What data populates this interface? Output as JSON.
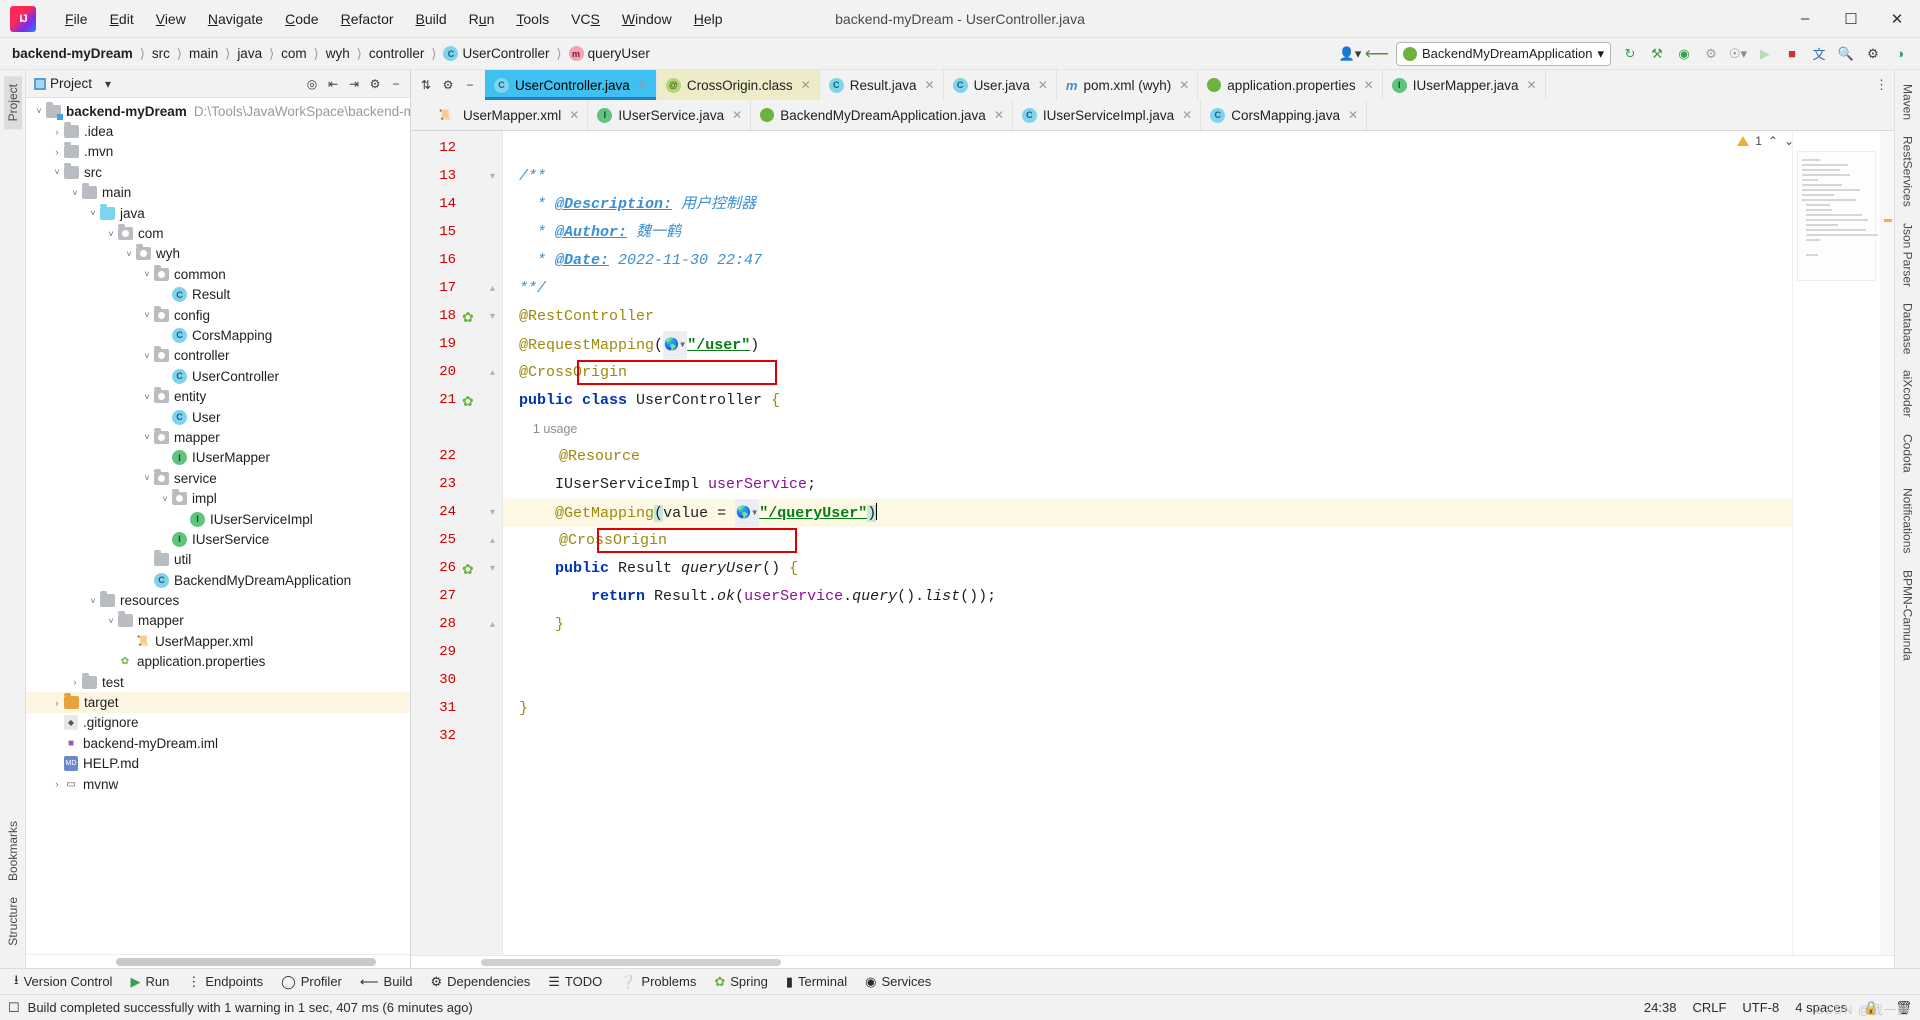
{
  "window": {
    "title": "backend-myDream - UserController.java",
    "logo_text": "IJ",
    "minimize": "–",
    "maximize": "❐",
    "close": "✕"
  },
  "menu": [
    "File",
    "Edit",
    "View",
    "Navigate",
    "Code",
    "Refactor",
    "Build",
    "Run",
    "Tools",
    "VCS",
    "Window",
    "Help"
  ],
  "breadcrumbs": [
    {
      "label": "backend-myDream",
      "bold": true,
      "icon": ""
    },
    {
      "label": "src",
      "bold": false,
      "icon": ""
    },
    {
      "label": "main",
      "bold": false,
      "icon": ""
    },
    {
      "label": "java",
      "bold": false,
      "icon": ""
    },
    {
      "label": "com",
      "bold": false,
      "icon": ""
    },
    {
      "label": "wyh",
      "bold": false,
      "icon": ""
    },
    {
      "label": "controller",
      "bold": false,
      "icon": ""
    },
    {
      "label": "UserController",
      "bold": false,
      "icon": "class-badge"
    },
    {
      "label": "queryUser",
      "bold": false,
      "icon": "method-badge"
    }
  ],
  "toolbar": {
    "run_config": "BackendMyDreamApplication",
    "user_icon": "user-settings-icon",
    "back_icon": "back-arrow-icon",
    "icons": [
      "build-icon",
      "run-with-coverage-icon",
      "debug-icon",
      "profile-icon",
      "search-everywhere-icon",
      "run-icon",
      "stop-icon",
      "translate-icon",
      "search-icon",
      "settings-icon",
      "ai-assistant-icon"
    ],
    "dropdown_caret": "▾"
  },
  "project_panel": {
    "title": "Project",
    "caret": "▾",
    "header_icons": [
      "locate-icon",
      "expand-all-icon",
      "collapse-all-icon",
      "settings-icon",
      "hide-icon"
    ],
    "tree": [
      {
        "depth": 0,
        "arrow": "˅",
        "icon": "module-folder",
        "label": "backend-myDream",
        "bold": true,
        "path": "D:\\Tools\\JavaWorkSpace\\backend-my"
      },
      {
        "depth": 1,
        "arrow": "›",
        "icon": "folder",
        "label": ".idea"
      },
      {
        "depth": 1,
        "arrow": "›",
        "icon": "folder",
        "label": ".mvn"
      },
      {
        "depth": 1,
        "arrow": "˅",
        "icon": "folder",
        "label": "src"
      },
      {
        "depth": 2,
        "arrow": "˅",
        "icon": "folder",
        "label": "main"
      },
      {
        "depth": 3,
        "arrow": "˅",
        "icon": "folder-blue",
        "label": "java"
      },
      {
        "depth": 4,
        "arrow": "˅",
        "icon": "package",
        "label": "com"
      },
      {
        "depth": 5,
        "arrow": "˅",
        "icon": "package",
        "label": "wyh"
      },
      {
        "depth": 6,
        "arrow": "˅",
        "icon": "package",
        "label": "common"
      },
      {
        "depth": 7,
        "arrow": "",
        "icon": "class",
        "label": "Result"
      },
      {
        "depth": 6,
        "arrow": "˅",
        "icon": "package",
        "label": "config"
      },
      {
        "depth": 7,
        "arrow": "",
        "icon": "class",
        "label": "CorsMapping"
      },
      {
        "depth": 6,
        "arrow": "˅",
        "icon": "package",
        "label": "controller"
      },
      {
        "depth": 7,
        "arrow": "",
        "icon": "class",
        "label": "UserController"
      },
      {
        "depth": 6,
        "arrow": "˅",
        "icon": "package",
        "label": "entity"
      },
      {
        "depth": 7,
        "arrow": "",
        "icon": "class",
        "label": "User"
      },
      {
        "depth": 6,
        "arrow": "˅",
        "icon": "package",
        "label": "mapper"
      },
      {
        "depth": 7,
        "arrow": "",
        "icon": "interface",
        "label": "IUserMapper"
      },
      {
        "depth": 6,
        "arrow": "˅",
        "icon": "package",
        "label": "service"
      },
      {
        "depth": 7,
        "arrow": "˅",
        "icon": "package",
        "label": "impl"
      },
      {
        "depth": 8,
        "arrow": "",
        "icon": "interface",
        "label": "IUserServiceImpl"
      },
      {
        "depth": 7,
        "arrow": "",
        "icon": "interface",
        "label": "IUserService"
      },
      {
        "depth": 6,
        "arrow": "",
        "icon": "folder",
        "label": "util"
      },
      {
        "depth": 6,
        "arrow": "",
        "icon": "class",
        "label": "BackendMyDreamApplication"
      },
      {
        "depth": 3,
        "arrow": "˅",
        "icon": "folder",
        "label": "resources"
      },
      {
        "depth": 4,
        "arrow": "˅",
        "icon": "folder",
        "label": "mapper"
      },
      {
        "depth": 5,
        "arrow": "",
        "icon": "xml-file",
        "label": "UserMapper.xml"
      },
      {
        "depth": 4,
        "arrow": "",
        "icon": "properties-file",
        "label": "application.properties"
      },
      {
        "depth": 2,
        "arrow": "›",
        "icon": "folder",
        "label": "test"
      },
      {
        "depth": 1,
        "arrow": "›",
        "icon": "folder-orange",
        "label": "target",
        "selected": true
      },
      {
        "depth": 1,
        "arrow": "",
        "icon": "git-file",
        "label": ".gitignore"
      },
      {
        "depth": 1,
        "arrow": "",
        "icon": "iml-file",
        "label": "backend-myDream.iml"
      },
      {
        "depth": 1,
        "arrow": "",
        "icon": "md-file",
        "label": "HELP.md"
      },
      {
        "depth": 1,
        "arrow": "›",
        "icon": "sh-file",
        "label": "mvnw"
      }
    ]
  },
  "editor_tabs_row1": [
    {
      "label": "UserController.java",
      "icon": "class",
      "active": true
    },
    {
      "label": "CrossOrigin.class",
      "icon": "annotation",
      "active": false,
      "compiled": true
    },
    {
      "label": "Result.java",
      "icon": "class",
      "active": false
    },
    {
      "label": "User.java",
      "icon": "class",
      "active": false
    },
    {
      "label": "pom.xml (wyh)",
      "icon": "maven",
      "active": false
    },
    {
      "label": "application.properties",
      "icon": "properties",
      "active": false
    },
    {
      "label": "IUserMapper.java",
      "icon": "interface",
      "active": false
    }
  ],
  "editor_tabs_row2": [
    {
      "label": "UserMapper.xml",
      "icon": "xml"
    },
    {
      "label": "IUserService.java",
      "icon": "interface"
    },
    {
      "label": "BackendMyDreamApplication.java",
      "icon": "spring"
    },
    {
      "label": "IUserServiceImpl.java",
      "icon": "class"
    },
    {
      "label": "CorsMapping.java",
      "icon": "class"
    }
  ],
  "inspection": {
    "warning_count": "1",
    "up_caret": "⌃",
    "down_caret": "⌄"
  },
  "code": {
    "lines": [
      {
        "num": "12",
        "text": "",
        "gutter_icon": "",
        "fold": ""
      },
      {
        "num": "13",
        "text": "/**",
        "fold": "minus",
        "kind": "comment"
      },
      {
        "num": "14",
        "text": " * @Description: 用户控制器",
        "kind": "comment-tag",
        "tag": "@Description:",
        "value": "用户控制器"
      },
      {
        "num": "15",
        "text": " * @Author: 魏一鹤",
        "kind": "comment-tag",
        "tag": "@Author:",
        "value": "魏一鹤"
      },
      {
        "num": "16",
        "text": " * @Date: 2022-11-30 22:47",
        "kind": "comment-tag",
        "tag": "@Date:",
        "value": "2022-11-30 22:47"
      },
      {
        "num": "17",
        "text": "**/",
        "fold": "end",
        "kind": "comment"
      },
      {
        "num": "18",
        "text": "@RestController",
        "kind": "annotation",
        "gutter_icon": "spring-bean-icon",
        "fold": "minus"
      },
      {
        "num": "19",
        "text": "@RequestMapping(\"/user\")",
        "kind": "annotation-mapping",
        "mapping": "/user"
      },
      {
        "num": "20",
        "text": "@CrossOrigin",
        "kind": "annotation",
        "highlight_box": true,
        "fold": "end"
      },
      {
        "num": "21",
        "text": "public class UserController {",
        "kind": "decl",
        "gutter_icon": "spring-controller-icon"
      },
      {
        "num": "",
        "text": "1 usage",
        "kind": "usage"
      },
      {
        "num": "22",
        "text": "@Resource",
        "kind": "annotation"
      },
      {
        "num": "23",
        "text": "IUserServiceImpl userService;",
        "kind": "field"
      },
      {
        "num": "24",
        "text": "@GetMapping(value = \"/queryUser\")",
        "kind": "annotation-mapping",
        "mapping": "/queryUser",
        "current": true,
        "fold": "minus"
      },
      {
        "num": "25",
        "text": "@CrossOrigin",
        "kind": "annotation",
        "highlight_box": true,
        "fold": "end"
      },
      {
        "num": "26",
        "text": "public Result queryUser() {",
        "kind": "decl",
        "gutter_icon": "spring-mapping-icon",
        "fold": "minus"
      },
      {
        "num": "27",
        "text": "return Result.ok(userService.query().list());",
        "kind": "stmt"
      },
      {
        "num": "28",
        "text": "}",
        "kind": "plain",
        "fold": "end"
      },
      {
        "num": "29",
        "text": "",
        "kind": "plain"
      },
      {
        "num": "30",
        "text": "",
        "kind": "plain"
      },
      {
        "num": "31",
        "text": "}",
        "kind": "plain"
      },
      {
        "num": "32",
        "text": "",
        "kind": "plain"
      }
    ]
  },
  "left_rail": [
    "Project",
    "Bookmarks",
    "Structure"
  ],
  "right_rail": [
    "Maven",
    "RestServices",
    "Json Parser",
    "Database",
    "aiXcoder",
    "Codota",
    "Notifications",
    "BPMN-Camunda"
  ],
  "tool_windows": [
    {
      "label": "Version Control",
      "icon": "branch-icon"
    },
    {
      "label": "Run",
      "icon": "run-icon"
    },
    {
      "label": "Endpoints",
      "icon": "endpoints-icon"
    },
    {
      "label": "Profiler",
      "icon": "profiler-icon"
    },
    {
      "label": "Build",
      "icon": "build-icon"
    },
    {
      "label": "Dependencies",
      "icon": "dependencies-icon"
    },
    {
      "label": "TODO",
      "icon": "todo-icon"
    },
    {
      "label": "Problems",
      "icon": "problems-icon"
    },
    {
      "label": "Spring",
      "icon": "spring-icon"
    },
    {
      "label": "Terminal",
      "icon": "terminal-icon"
    },
    {
      "label": "Services",
      "icon": "services-icon"
    }
  ],
  "statusbar": {
    "message": "Build completed successfully with 1 warning in 1 sec, 407 ms (6 minutes ago)",
    "position": "24:38",
    "line_sep": "CRLF",
    "encoding": "UTF-8",
    "indent": "4 spaces",
    "watermark": "CSDN @我一鹤"
  },
  "colors": {
    "accent": "#3ec1f0",
    "annotation": "#9e880d",
    "keyword": "#0033b3",
    "string": "#067d17",
    "comment": "#3a8fd4",
    "error_box": "#e00000",
    "line_number": "#cc0000"
  }
}
